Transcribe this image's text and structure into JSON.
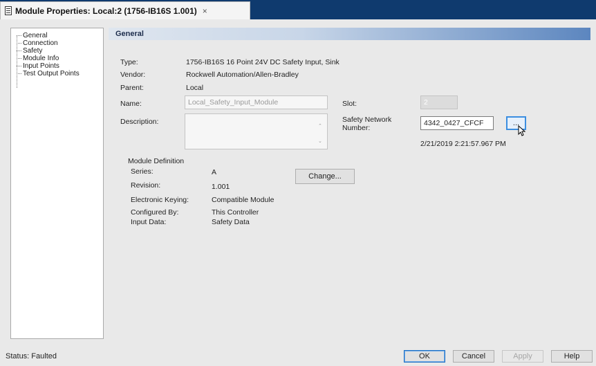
{
  "window": {
    "tab_title": "Module Properties: Local:2 (1756-IB16S 1.001)",
    "close_glyph": "×"
  },
  "nav": {
    "items": [
      {
        "label": "General"
      },
      {
        "label": "Connection"
      },
      {
        "label": "Safety"
      },
      {
        "label": "Module Info"
      },
      {
        "label": "Input Points"
      },
      {
        "label": "Test Output Points"
      }
    ]
  },
  "panel": {
    "header": "General",
    "type_label": "Type:",
    "type_value": "1756-IB16S 16 Point 24V DC Safety Input, Sink",
    "vendor_label": "Vendor:",
    "vendor_value": "Rockwell Automation/Allen-Bradley",
    "parent_label": "Parent:",
    "parent_value": "Local",
    "name_label": "Name:",
    "name_value": "Local_Safety_Input_Module",
    "slot_label": "Slot:",
    "slot_value": "2",
    "description_label": "Description:",
    "description_value": "",
    "snn_label_1": "Safety Network",
    "snn_label_2": "Number:",
    "snn_value": "4342_0427_CFCF",
    "snn_browse": "...",
    "snn_timestamp": "2/21/2019 2:21:57.967 PM",
    "module_definition": {
      "title": "Module Definition",
      "series_label": "Series:",
      "series_value": "A",
      "revision_label": "Revision:",
      "revision_value": "1.001",
      "keying_label": "Electronic Keying:",
      "keying_value": "Compatible Module",
      "configured_label": "Configured By:",
      "configured_value": "This Controller",
      "input_label": "Input Data:",
      "input_value": "Safety Data",
      "change_button": "Change..."
    }
  },
  "status": {
    "text": "Status:  Faulted"
  },
  "buttons": {
    "ok": "OK",
    "cancel": "Cancel",
    "apply": "Apply",
    "help": "Help"
  },
  "colors": {
    "title_bar": "#0f3a6e",
    "header_gradient_end": "#5c86bf",
    "default_button_border": "#1c6fc4"
  }
}
